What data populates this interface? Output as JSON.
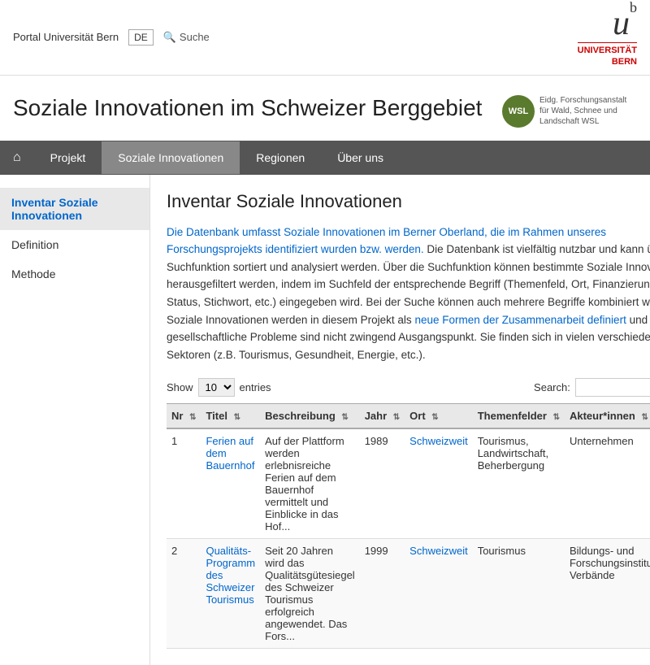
{
  "topbar": {
    "portal_label": "Portal Universität Bern",
    "lang_label": "DE",
    "search_label": "Suche",
    "uni_logo_line1": "b",
    "uni_logo_line2": "UNIVERSITÄT",
    "uni_logo_line3": "BERN",
    "ub_letter": "u",
    "ub_superscript": "b"
  },
  "wsl": {
    "circle_text": "WSL",
    "full_text": "Eidg. Forschungsanstalt für Wald, Schnee und Landschaft WSL"
  },
  "hero": {
    "title": "Soziale Innovationen im Schweizer Berggebiet"
  },
  "nav": {
    "home_icon": "⌂",
    "items": [
      {
        "label": "Projekt",
        "active": false
      },
      {
        "label": "Soziale Innovationen",
        "active": true
      },
      {
        "label": "Regionen",
        "active": false
      },
      {
        "label": "Über uns",
        "active": false
      }
    ]
  },
  "sidebar": {
    "items": [
      {
        "label": "Inventar Soziale Innovationen",
        "active": true
      },
      {
        "label": "Definition",
        "active": false
      },
      {
        "label": "Methode",
        "active": false
      }
    ]
  },
  "content": {
    "title": "Inventar Soziale Innovationen",
    "intro_link_text": "Die Datenbank umfasst Soziale Innovationen im Berner Oberland, die im Rahmen unseres Forschungsprojekts identifiziert wurden bzw. werden.",
    "intro_rest": " Die Datenbank ist vielfältig nutzbar und kann über die Suchfunktion sortiert und analysiert werden. Über die Suchfunktion können bestimmte Soziale Innovationen herausgefiltert werden, indem im Suchfeld der entsprechende Begriff (Themenfeld, Ort, Finanzierung, Status, Stichwort, etc.) eingegeben wird. Bei der Suche können auch mehrere Begriffe kombiniert werden. Soziale Innovationen werden in diesem Projekt als ",
    "intro_link2": "neue Formen der Zusammenarbeit definiert",
    "intro_rest2": " und gesellschaftliche Probleme sind nicht zwingend Ausgangspunkt. Sie finden sich in vielen verschiedenen Sektoren (z.B. Tourismus, Gesundheit, Energie, etc.).",
    "show_label": "Show",
    "show_value": "10",
    "entries_label": "entries",
    "search_label": "Search:",
    "search_value": "",
    "columns": [
      {
        "key": "nr",
        "label": "Nr"
      },
      {
        "key": "titel",
        "label": "Titel"
      },
      {
        "key": "beschreibung",
        "label": "Beschreibung"
      },
      {
        "key": "jahr",
        "label": "Jahr"
      },
      {
        "key": "ort",
        "label": "Ort"
      },
      {
        "key": "themenfelder",
        "label": "Themenfelder"
      },
      {
        "key": "akteur",
        "label": "Akteur*innen"
      }
    ],
    "rows": [
      {
        "nr": "1",
        "titel": "Ferien auf dem Bauernhof",
        "titel_link": true,
        "beschreibung": "Auf der Plattform werden erlebnisreiche Ferien auf dem Bauernhof vermittelt und Einblicke in das Hof...",
        "jahr": "1989",
        "ort": "Schweizweit",
        "ort_link": true,
        "themenfelder": "Tourismus, Landwirtschaft, Beherbergung",
        "akteur": "Unternehmen"
      },
      {
        "nr": "2",
        "titel": "Qualitäts-Programm des Schweizer Tourismus",
        "titel_link": true,
        "beschreibung": "Seit 20 Jahren wird das Qualitätsgütesiegel des Schweizer Tourismus erfolgreich angewendet. Das Fors...",
        "jahr": "1999",
        "ort": "Schweizweit",
        "ort_link": true,
        "themenfelder": "Tourismus",
        "akteur": "Bildungs- und Forschungsinstitutionen, Verbände"
      }
    ]
  }
}
